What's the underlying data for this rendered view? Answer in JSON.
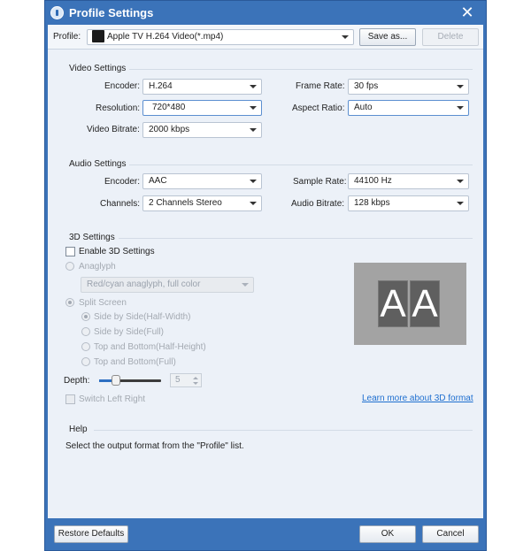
{
  "window": {
    "title": "Profile Settings"
  },
  "profile": {
    "label": "Profile:",
    "value": "Apple TV H.264 Video(*.mp4)",
    "save_as": "Save as...",
    "delete": "Delete"
  },
  "video": {
    "title": "Video Settings",
    "encoder_label": "Encoder:",
    "encoder_value": "H.264",
    "resolution_label": "Resolution:",
    "resolution_value": "720*480",
    "bitrate_label": "Video Bitrate:",
    "bitrate_value": "2000 kbps",
    "framerate_label": "Frame Rate:",
    "framerate_value": "30 fps",
    "aspect_label": "Aspect Ratio:",
    "aspect_value": "Auto"
  },
  "audio": {
    "title": "Audio Settings",
    "encoder_label": "Encoder:",
    "encoder_value": "AAC",
    "channels_label": "Channels:",
    "channels_value": "2 Channels Stereo",
    "samplerate_label": "Sample Rate:",
    "samplerate_value": "44100 Hz",
    "bitrate_label": "Audio Bitrate:",
    "bitrate_value": "128 kbps"
  },
  "three_d": {
    "title": "3D Settings",
    "enable_label": "Enable 3D Settings",
    "anaglyph_label": "Anaglyph",
    "anaglyph_value": "Red/cyan anaglyph, full color",
    "split_label": "Split Screen",
    "split_options": [
      "Side by Side(Half-Width)",
      "Side by Side(Full)",
      "Top and Bottom(Half-Height)",
      "Top and Bottom(Full)"
    ],
    "depth_label": "Depth:",
    "depth_value": "5",
    "switch_label": "Switch Left Right",
    "learn_more": "Learn more about 3D format",
    "preview_letters": [
      "A",
      "A"
    ]
  },
  "help": {
    "title": "Help",
    "text": "Select the output format from the \"Profile\" list."
  },
  "footer": {
    "restore": "Restore Defaults",
    "ok": "OK",
    "cancel": "Cancel"
  },
  "colors": {
    "titlebar": "#3b73b9",
    "link": "#1e6fd0",
    "panel": "#ecf1f8"
  }
}
